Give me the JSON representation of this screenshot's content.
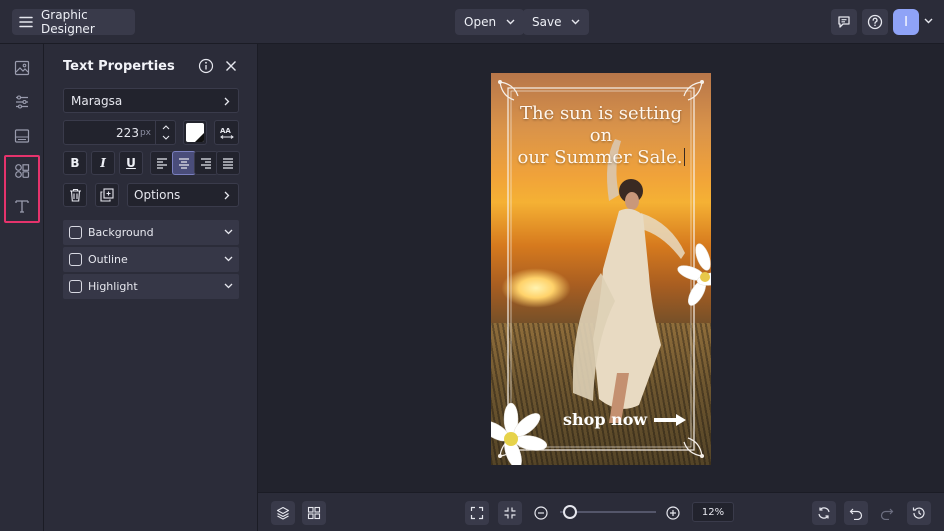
{
  "app": {
    "title": "Graphic Designer"
  },
  "header": {
    "open_label": "Open",
    "save_label": "Save",
    "user_initial": "I"
  },
  "panel": {
    "title": "Text Properties",
    "font_name": "Maragsa",
    "font_size": "223",
    "font_size_unit": "px",
    "text_color": "#ffffff",
    "format_bold": "B",
    "format_italic": "I",
    "format_underline": "U",
    "alignment_selected": "center",
    "options_label": "Options",
    "sections": [
      {
        "label": "Background",
        "checked": false
      },
      {
        "label": "Outline",
        "checked": false
      },
      {
        "label": "Highlight",
        "checked": false
      }
    ]
  },
  "design": {
    "headline_line1": "The sun is setting on",
    "headline_line2": "our Summer Sale.",
    "cta": "shop now"
  },
  "footer": {
    "zoom": "12%",
    "zoom_level": 0.05
  },
  "colors": {
    "accent": "#e5336c",
    "avatar": "#8fa3f7",
    "selected_align": "#4a4d7a"
  }
}
